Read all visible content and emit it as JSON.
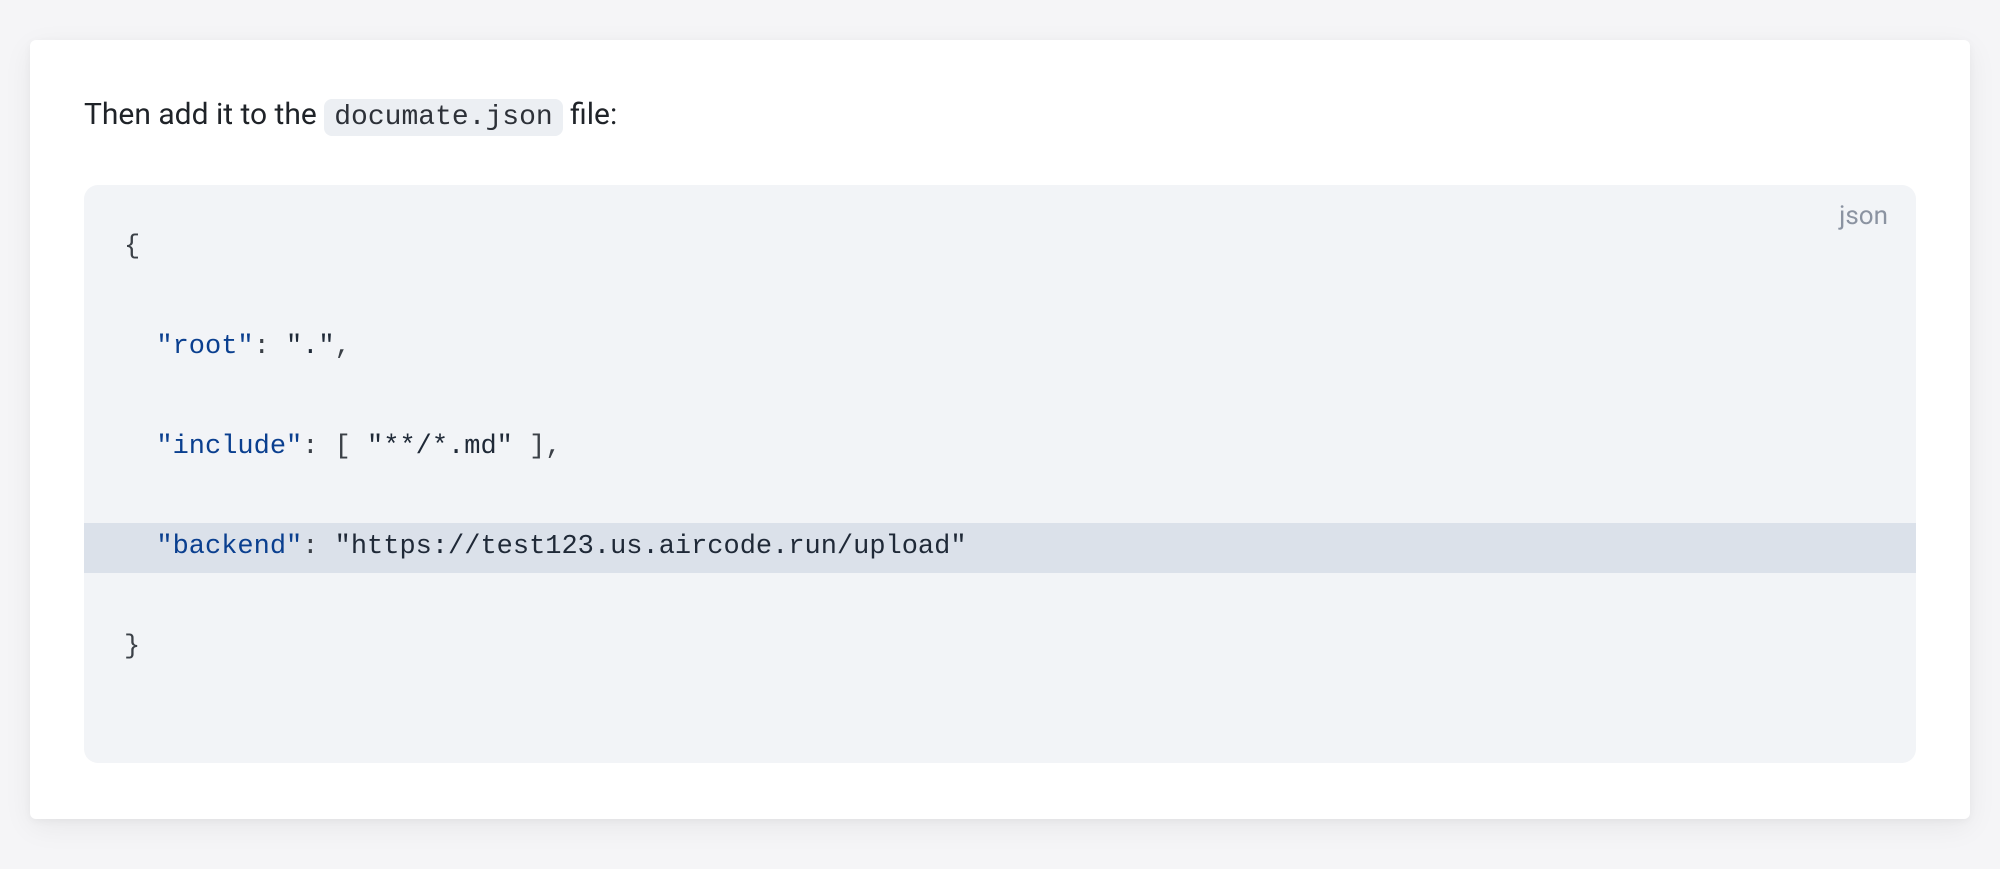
{
  "intro": {
    "prefix": "Then add it to the ",
    "code": "documate.json",
    "suffix": " file:"
  },
  "codeBlock": {
    "language": "json",
    "lines": [
      {
        "highlighted": false,
        "segments": [
          {
            "cls": "tok-punct",
            "text": "{"
          }
        ]
      },
      {
        "highlighted": false,
        "segments": [
          {
            "cls": "",
            "text": "  "
          },
          {
            "cls": "tok-key",
            "text": "\"root\""
          },
          {
            "cls": "tok-punct",
            "text": ": "
          },
          {
            "cls": "tok-string",
            "text": "\".\""
          },
          {
            "cls": "tok-punct",
            "text": ","
          }
        ]
      },
      {
        "highlighted": false,
        "segments": [
          {
            "cls": "",
            "text": "  "
          },
          {
            "cls": "tok-key",
            "text": "\"include\""
          },
          {
            "cls": "tok-punct",
            "text": ": "
          },
          {
            "cls": "tok-bracket",
            "text": "[ "
          },
          {
            "cls": "tok-string",
            "text": "\"**/*.md\""
          },
          {
            "cls": "tok-bracket",
            "text": " ]"
          },
          {
            "cls": "tok-punct",
            "text": ","
          }
        ]
      },
      {
        "highlighted": true,
        "segments": [
          {
            "cls": "",
            "text": "  "
          },
          {
            "cls": "tok-key",
            "text": "\"backend\""
          },
          {
            "cls": "tok-punct",
            "text": ": "
          },
          {
            "cls": "tok-string",
            "text": "\"https://test123.us.aircode.run/upload\""
          }
        ]
      },
      {
        "highlighted": false,
        "segments": [
          {
            "cls": "tok-punct",
            "text": "}"
          }
        ]
      }
    ]
  }
}
